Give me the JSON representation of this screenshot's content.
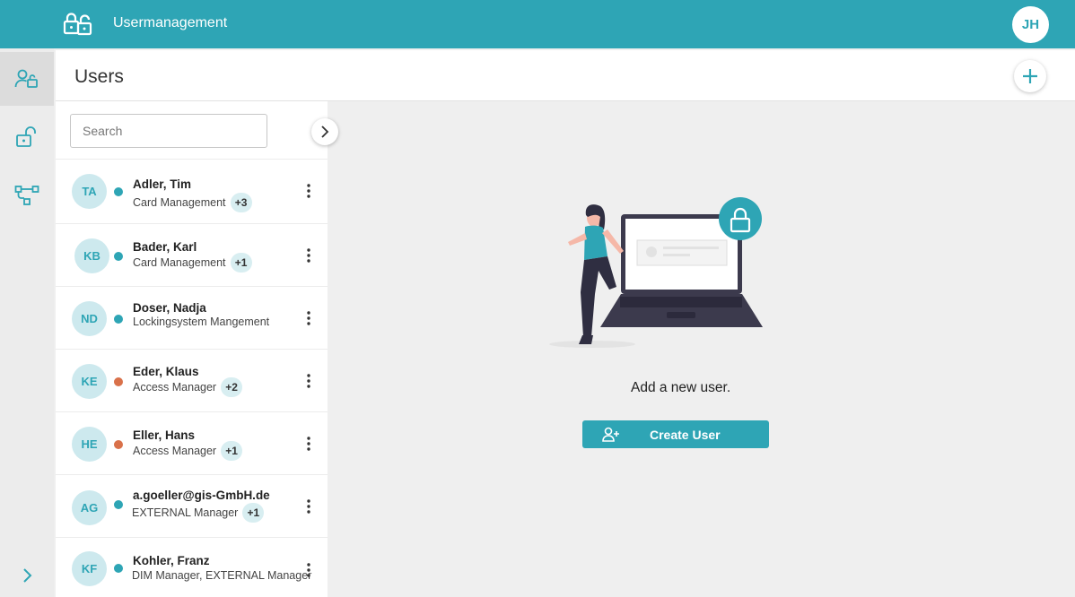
{
  "topbar": {
    "app_title": "Usermanagement",
    "avatar_initials": "JH",
    "logo_icon": "locks-logo-icon"
  },
  "rail": {
    "items": [
      {
        "icon": "user-lock-icon",
        "active": true
      },
      {
        "icon": "unlock-icon",
        "active": false
      },
      {
        "icon": "hierarchy-icon",
        "active": false
      }
    ],
    "expand_icon": "chevron-right-icon"
  },
  "header": {
    "title": "Users",
    "add_icon": "plus-icon"
  },
  "search": {
    "placeholder": "Search",
    "value": ""
  },
  "users": [
    {
      "initials": "TA",
      "name": "Adler, Tim",
      "role": "Card Management",
      "extra": "+3",
      "status_color": "#2ea5b5"
    },
    {
      "initials": "KB",
      "name": "Bader, Karl",
      "role": "Card Management",
      "extra": "+1",
      "status_color": "#2ea5b5"
    },
    {
      "initials": "ND",
      "name": "Doser, Nadja",
      "role": "Lockingsystem Mangement",
      "extra": "",
      "status_color": "#2ea5b5"
    },
    {
      "initials": "KE",
      "name": "Eder, Klaus",
      "role": "Access Manager",
      "extra": "+2",
      "status_color": "#d9714a"
    },
    {
      "initials": "HE",
      "name": "Eller, Hans",
      "role": "Access Manager",
      "extra": "+1",
      "status_color": "#d9714a"
    },
    {
      "initials": "AG",
      "name": "a.goeller@gis-GmbH.de",
      "role": "EXTERNAL Manager",
      "extra": "+1",
      "status_color": "#2ea5b5"
    },
    {
      "initials": "KF",
      "name": "Kohler, Franz",
      "role": "DIM Manager, EXTERNAL Manager",
      "extra": "",
      "status_color": "#2ea5b5"
    }
  ],
  "empty_state": {
    "text": "Add a new user.",
    "create_button": "Create User",
    "illustration": "woman-with-laptop-illustration"
  },
  "colors": {
    "accent": "#2ea5b5",
    "status_active": "#2ea5b5",
    "status_warning": "#d9714a"
  }
}
